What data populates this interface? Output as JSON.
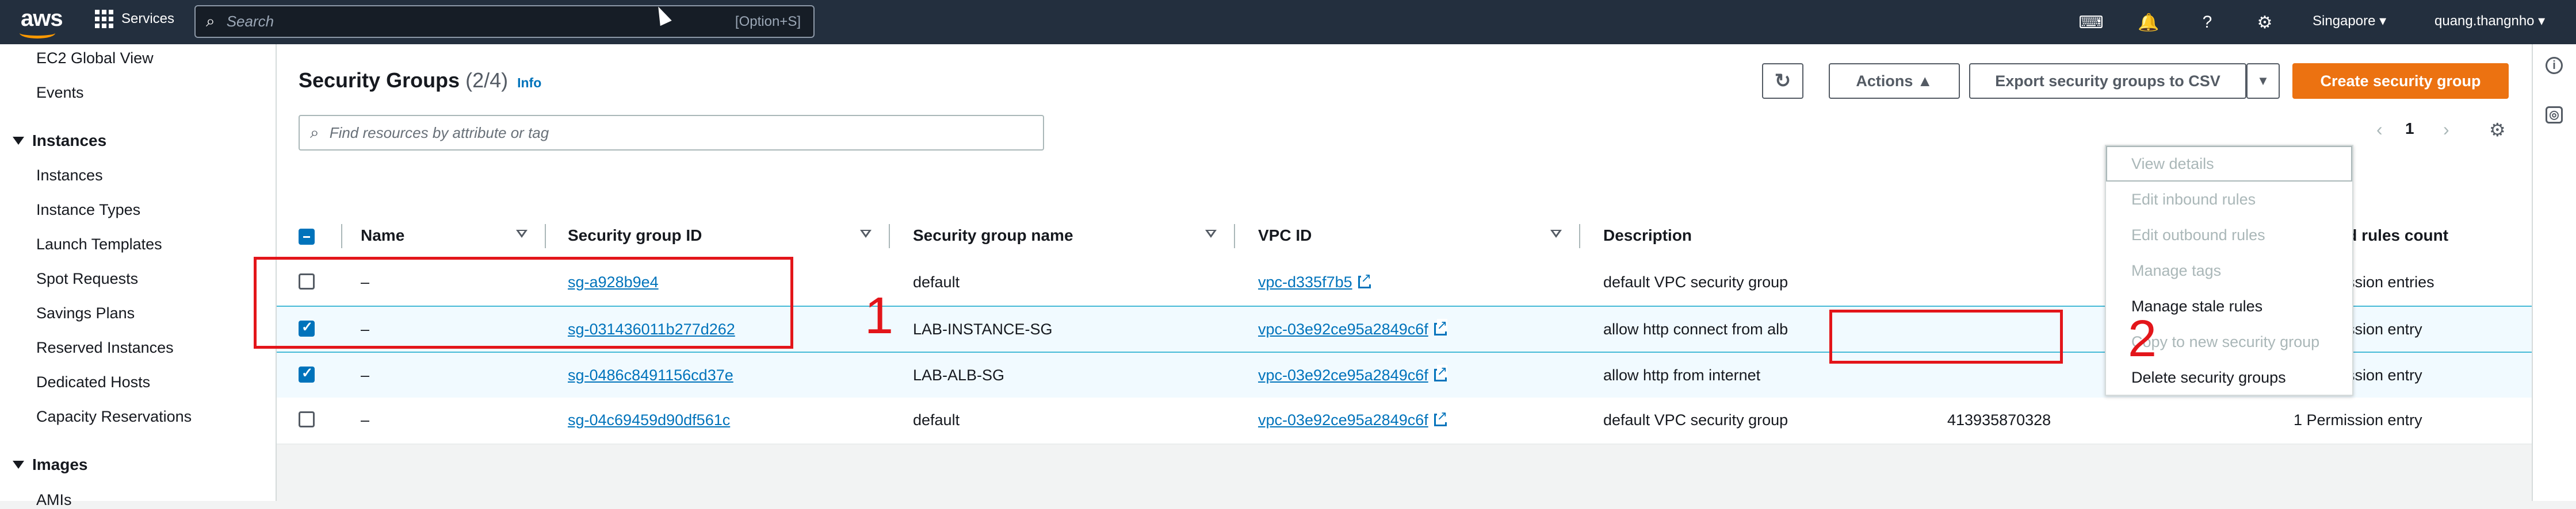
{
  "topbar": {
    "logo": "aws",
    "services_label": "Services",
    "search_placeholder": "Search",
    "search_shortcut": "[Option+S]",
    "icons": [
      "cloudshell-icon",
      "bell-icon",
      "help-icon",
      "gear-icon"
    ],
    "region": "Singapore ▾",
    "user": "quang.thangnho ▾"
  },
  "sidebar": {
    "items_top": [
      "EC2 Global View",
      "Events"
    ],
    "section_instances": "Instances",
    "instances_items": [
      "Instances",
      "Instance Types",
      "Launch Templates",
      "Spot Requests",
      "Savings Plans",
      "Reserved Instances",
      "Dedicated Hosts",
      "Capacity Reservations"
    ],
    "section_images": "Images",
    "images_partial": "AMIs"
  },
  "panel": {
    "title": "Security Groups",
    "count": "(2/4)",
    "info": "Info",
    "refresh_icon": "refresh-icon",
    "actions_label": "Actions ▲",
    "export_label": "Export security groups to CSV",
    "create_label": "Create security group",
    "find_placeholder": "Find resources by attribute or tag",
    "page": "1"
  },
  "table": {
    "headers": {
      "name": "Name",
      "sg_id": "Security group ID",
      "sg_name": "Security group name",
      "vpc_id": "VPC ID",
      "description": "Description",
      "inbound": "Inbound rules count"
    },
    "rows": [
      {
        "name": "–",
        "sg_id": "sg-a928b9e4",
        "sg_name": "default",
        "vpc_id": "vpc-d335f7b5",
        "description": "default VPC security group",
        "owner": "",
        "inbound": "3 Permission entries",
        "selected": false
      },
      {
        "name": "–",
        "sg_id": "sg-031436011b277d262",
        "sg_name": "LAB-INSTANCE-SG",
        "vpc_id": "vpc-03e92ce95a2849c6f",
        "description": "allow http connect from alb",
        "owner": "",
        "inbound": "1 Permission entry",
        "selected": true
      },
      {
        "name": "–",
        "sg_id": "sg-0486c8491156cd37e",
        "sg_name": "LAB-ALB-SG",
        "vpc_id": "vpc-03e92ce95a2849c6f",
        "description": "allow http from internet",
        "owner": "",
        "inbound": "1 Permission entry",
        "selected": true
      },
      {
        "name": "–",
        "sg_id": "sg-04c69459d90df561c",
        "sg_name": "default",
        "vpc_id": "vpc-03e92ce95a2849c6f",
        "description": "default VPC security group",
        "owner": "413935870328",
        "inbound": "1 Permission entry",
        "selected": false
      }
    ]
  },
  "actions_menu": {
    "items": [
      {
        "label": "View details",
        "enabled": false
      },
      {
        "label": "Edit inbound rules",
        "enabled": false
      },
      {
        "label": "Edit outbound rules",
        "enabled": false
      },
      {
        "label": "Manage tags",
        "enabled": false
      },
      {
        "label": "Manage stale rules",
        "enabled": true
      },
      {
        "label": "Copy to new security group",
        "enabled": false
      },
      {
        "label": "Delete security groups",
        "enabled": true
      }
    ]
  },
  "annotations": {
    "step1": "1",
    "step2": "2",
    "color": "#e3151a"
  }
}
